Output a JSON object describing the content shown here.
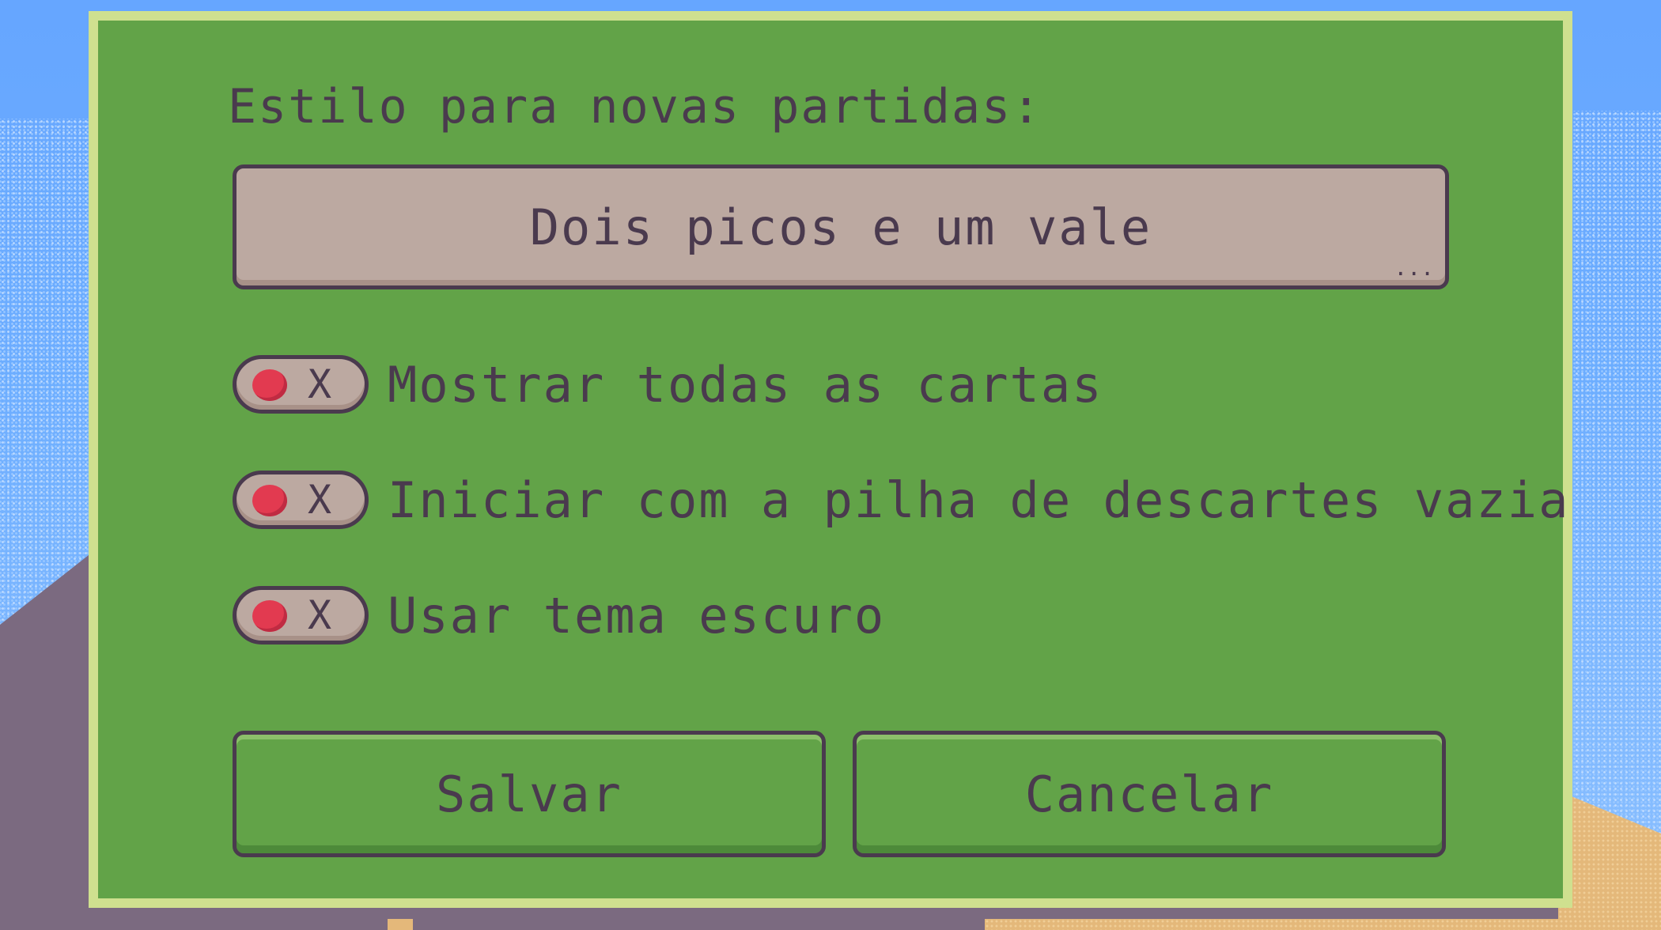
{
  "dialog": {
    "section_label": "Estilo para novas partidas:",
    "style_select": {
      "value": "Dois picos e um vale",
      "more_indicator": "..."
    },
    "options": [
      {
        "label": "Mostrar todas as cartas",
        "enabled": false,
        "toggle_mark": "X"
      },
      {
        "label": "Iniciar com a pilha de descartes vazia",
        "enabled": false,
        "toggle_mark": "X"
      },
      {
        "label": "Usar tema escuro",
        "enabled": false,
        "toggle_mark": "X"
      }
    ],
    "buttons": {
      "save_label": "Salvar",
      "cancel_label": "Cancelar"
    }
  },
  "colors": {
    "panel_green": "#62a348",
    "panel_border": "#cfe08f",
    "text_dark": "#4a3a4e",
    "control_fill": "#bca9a1",
    "toggle_off_red": "#e23a50",
    "sky_blue": "#6aa9ff"
  }
}
